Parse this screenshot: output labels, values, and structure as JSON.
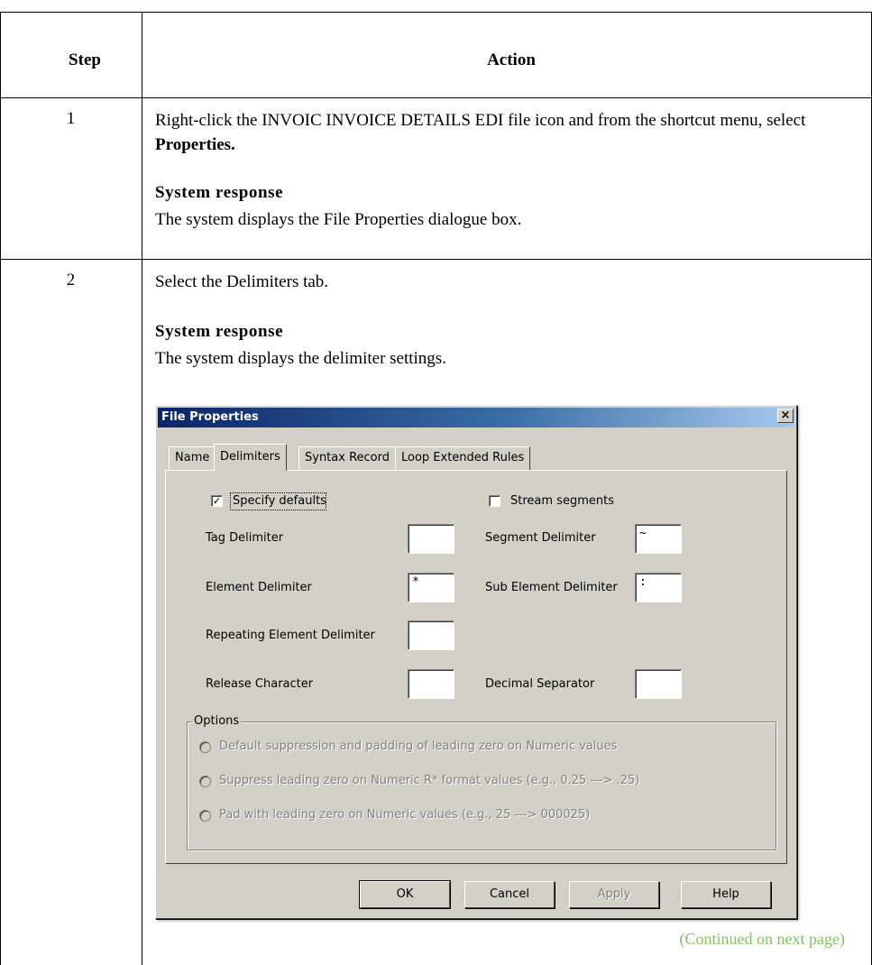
{
  "table": {
    "header_step": "Step",
    "header_action": "Action"
  },
  "steps": [
    {
      "number": "1",
      "text_pre": "Right-click the INVOIC INVOICE DETAILS EDI file icon and from the shortcut menu, select ",
      "text_bold": "Properties.",
      "response_title": "System response",
      "response_text": "The system displays the File Properties dialogue box."
    },
    {
      "number": "2",
      "text": "Select the Delimiters tab.",
      "response_title": "System response",
      "response_text": "The system displays the delimiter settings."
    }
  ],
  "dialog": {
    "title": "File Properties",
    "close_glyph": "×",
    "tabs": [
      "Name",
      "Delimiters",
      "Syntax Record",
      "Loop Extended Rules"
    ],
    "active_tab": "Delimiters",
    "specify_defaults": {
      "label": "Specify defaults",
      "checked": true
    },
    "stream_segments": {
      "label": "Stream segments",
      "checked": false
    },
    "fields": {
      "tag_delimiter": {
        "label": "Tag Delimiter",
        "value": ""
      },
      "segment_delimiter": {
        "label": "Segment Delimiter",
        "value": "~"
      },
      "element_delimiter": {
        "label": "Element Delimiter",
        "value": "*"
      },
      "sub_element_delimiter": {
        "label": "Sub Element Delimiter",
        "value": ":"
      },
      "repeating_element_delimiter": {
        "label": "Repeating Element Delimiter",
        "value": ""
      },
      "release_character": {
        "label": "Release Character",
        "value": ""
      },
      "decimal_separator": {
        "label": "Decimal Separator",
        "value": ""
      }
    },
    "options": {
      "title": "Options",
      "items": [
        "Default suppression and padding of leading zero on Numeric values",
        "Suppress leading zero on Numeric R* format values (e.g., 0.25 ---> .25)",
        "Pad with leading zero on Numeric values (e.g., 25 ---> 000025)"
      ],
      "enabled": false
    },
    "buttons": {
      "ok": "OK",
      "cancel": "Cancel",
      "apply": "Apply",
      "help": "Help"
    }
  },
  "footer": {
    "continued": "(Continued on next page)"
  },
  "colors": {
    "title_start": "#0a246a",
    "title_end": "#a6caf0",
    "dialog_bg": "#d4d0c8",
    "continued": "#7fc45a"
  }
}
